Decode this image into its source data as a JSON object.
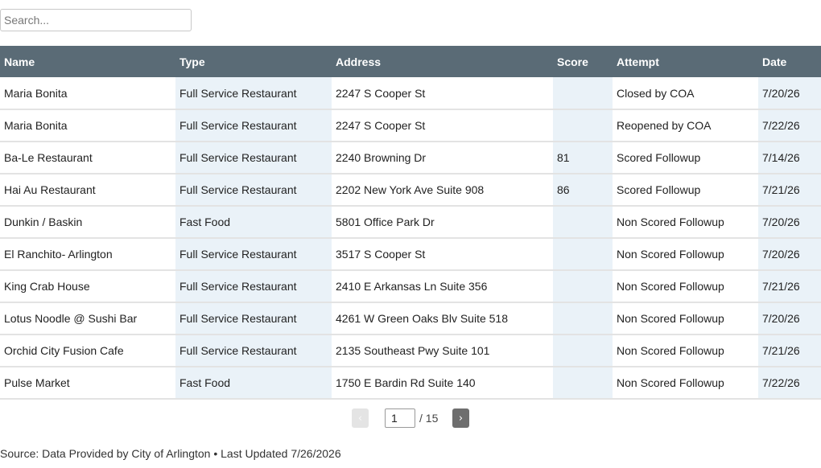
{
  "search": {
    "placeholder": "Search...",
    "value": ""
  },
  "table": {
    "headers": [
      "Name",
      "Type",
      "Address",
      "Score",
      "Attempt",
      "Date"
    ],
    "rows": [
      [
        "Maria Bonita",
        "Full Service Restaurant",
        "2247 S Cooper St",
        "",
        "Closed by COA",
        "7/20/26"
      ],
      [
        "Maria Bonita",
        "Full Service Restaurant",
        "2247 S Cooper St",
        "",
        "Reopened by COA",
        "7/22/26"
      ],
      [
        "Ba-Le Restaurant",
        "Full Service Restaurant",
        "2240 Browning Dr",
        "81",
        "Scored Followup",
        "7/14/26"
      ],
      [
        "Hai Au Restaurant",
        "Full Service Restaurant",
        "2202 New York Ave Suite 908",
        "86",
        "Scored Followup",
        "7/21/26"
      ],
      [
        "Dunkin / Baskin",
        "Fast Food",
        "5801 Office Park Dr",
        "",
        "Non Scored Followup",
        "7/20/26"
      ],
      [
        "El Ranchito- Arlington",
        "Full Service Restaurant",
        "3517 S Cooper St",
        "",
        "Non Scored Followup",
        "7/20/26"
      ],
      [
        "King Crab House",
        "Full Service Restaurant",
        "2410 E Arkansas Ln Suite 356",
        "",
        "Non Scored Followup",
        "7/21/26"
      ],
      [
        "Lotus Noodle @ Sushi Bar",
        "Full Service Restaurant",
        "4261 W Green Oaks Blv Suite 518",
        "",
        "Non Scored Followup",
        "7/20/26"
      ],
      [
        "Orchid City Fusion Cafe",
        "Full Service Restaurant",
        "2135 Southeast Pwy Suite 101",
        "",
        "Non Scored Followup",
        "7/21/26"
      ],
      [
        "Pulse Market",
        "Fast Food",
        "1750 E Bardin Rd Suite 140",
        "",
        "Non Scored Followup",
        "7/22/26"
      ]
    ]
  },
  "pagination": {
    "prev_icon": "‹",
    "next_icon": "›",
    "current_page": "1",
    "total_label": "/ 15"
  },
  "footer": {
    "source": "Source: Data Provided by City of Arlington • Last Updated 7/26/2026"
  },
  "colors": {
    "header_bg": "#5a6b76",
    "shaded_column": "#eaf2f8",
    "next_button": "#6e6e6e"
  }
}
